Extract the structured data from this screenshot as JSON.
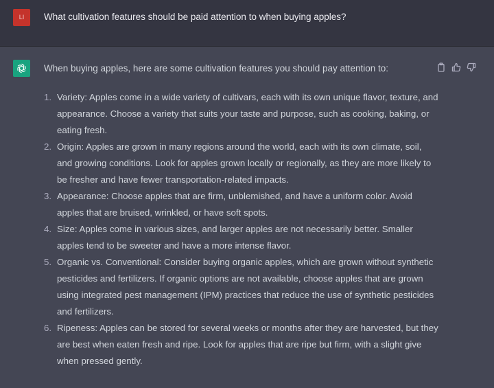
{
  "user": {
    "avatar_initials": "LI",
    "message": "What cultivation features should be paid attention to when buying apples?"
  },
  "assistant": {
    "intro": "When buying apples, here are some cultivation features you should pay attention to:",
    "items": [
      {
        "num": "1.",
        "text": "Variety: Apples come in a wide variety of cultivars, each with its own unique flavor, texture, and appearance. Choose a variety that suits your taste and purpose, such as cooking, baking, or eating fresh."
      },
      {
        "num": "2.",
        "text": "Origin: Apples are grown in many regions around the world, each with its own climate, soil, and growing conditions. Look for apples grown locally or regionally, as they are more likely to be fresher and have fewer transportation-related impacts."
      },
      {
        "num": "3.",
        "text": "Appearance: Choose apples that are firm, unblemished, and have a uniform color. Avoid apples that are bruised, wrinkled, or have soft spots."
      },
      {
        "num": "4.",
        "text": "Size: Apples come in various sizes, and larger apples are not necessarily better. Smaller apples tend to be sweeter and have a more intense flavor."
      },
      {
        "num": "5.",
        "text": "Organic vs. Conventional: Consider buying organic apples, which are grown without synthetic pesticides and fertilizers. If organic options are not available, choose apples that are grown using integrated pest management (IPM) practices that reduce the use of synthetic pesticides and fertilizers."
      },
      {
        "num": "6.",
        "text": "Ripeness: Apples can be stored for several weeks or months after they are harvested, but they are best when eaten fresh and ripe. Look for apples that are ripe but firm, with a slight give when pressed gently."
      }
    ]
  },
  "actions": {
    "icons": [
      "clipboard-icon",
      "thumbs-up-icon",
      "thumbs-down-icon"
    ]
  },
  "colors": {
    "user_bg": "#343541",
    "assistant_bg": "#444654",
    "user_avatar": "#c4332b",
    "bot_avatar": "#19a37f"
  }
}
